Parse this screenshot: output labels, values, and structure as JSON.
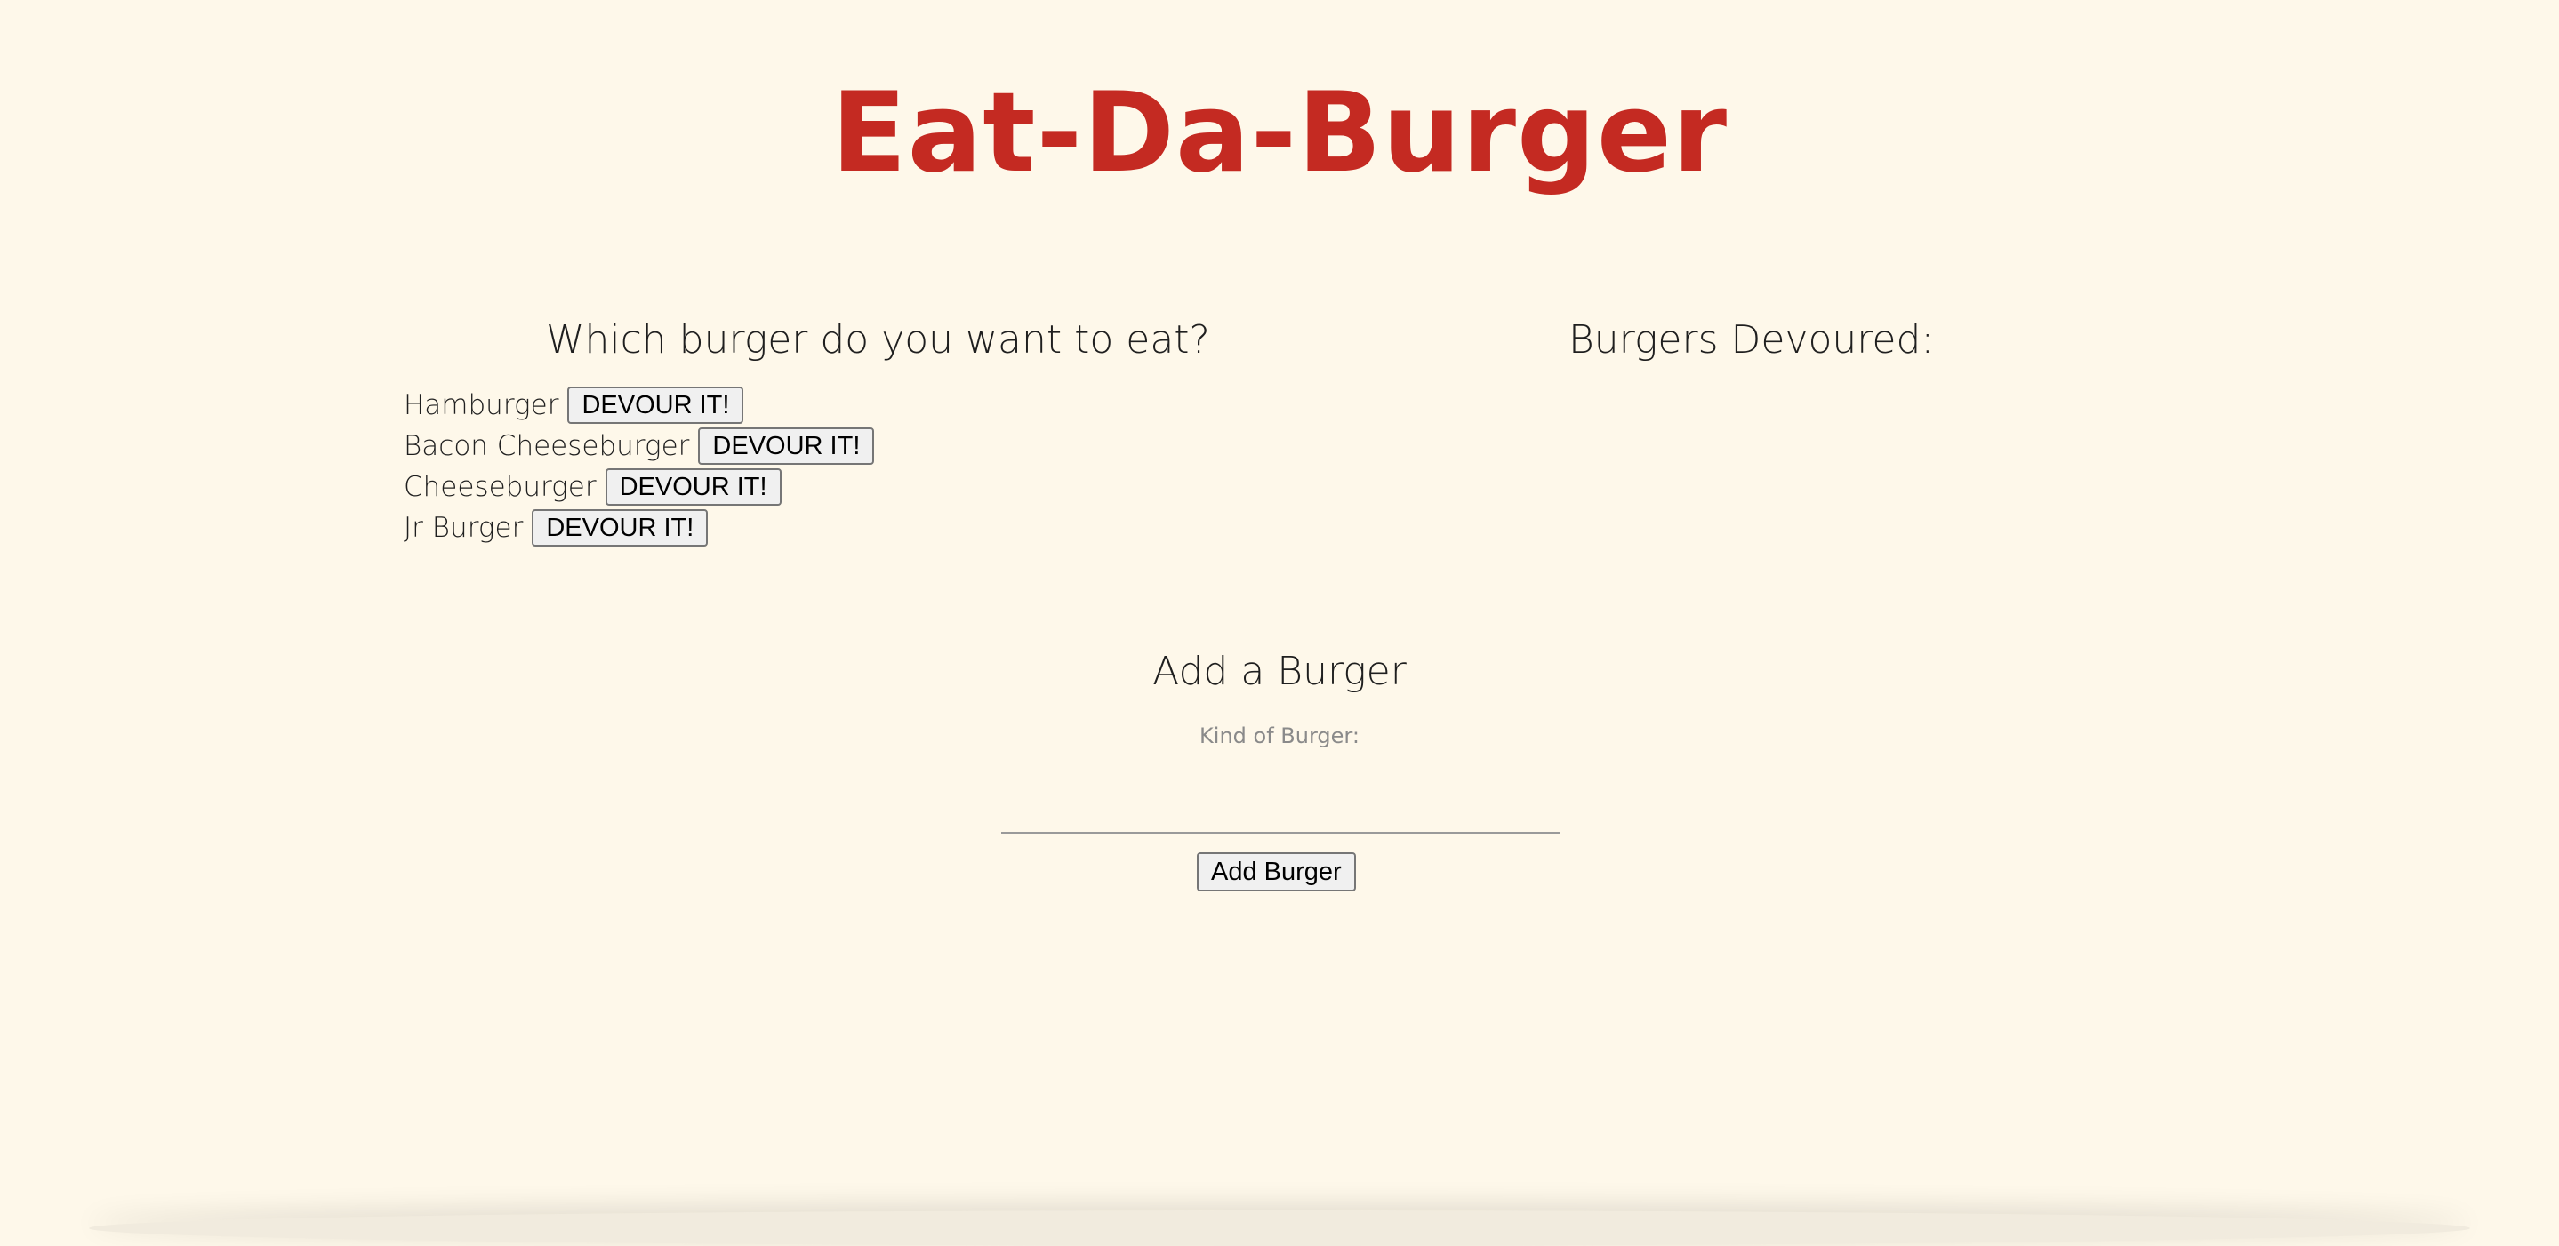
{
  "page": {
    "title": "Eat-Da-Burger"
  },
  "left_column": {
    "heading": "Which burger do you want to eat?",
    "burgers": [
      {
        "name": "Hamburger",
        "button_label": "DEVOUR IT!"
      },
      {
        "name": "Bacon Cheeseburger",
        "button_label": "DEVOUR IT!"
      },
      {
        "name": "Cheeseburger",
        "button_label": "DEVOUR IT!"
      },
      {
        "name": "Jr Burger",
        "button_label": "DEVOUR IT!"
      }
    ]
  },
  "right_column": {
    "heading": "Burgers Devoured:"
  },
  "add_form": {
    "heading": "Add a Burger",
    "input_label": "Kind of Burger:",
    "input_value": "",
    "input_placeholder": "",
    "submit_label": "Add Burger"
  },
  "colors": {
    "background": "#fef8ea",
    "title": "#c42a22"
  }
}
